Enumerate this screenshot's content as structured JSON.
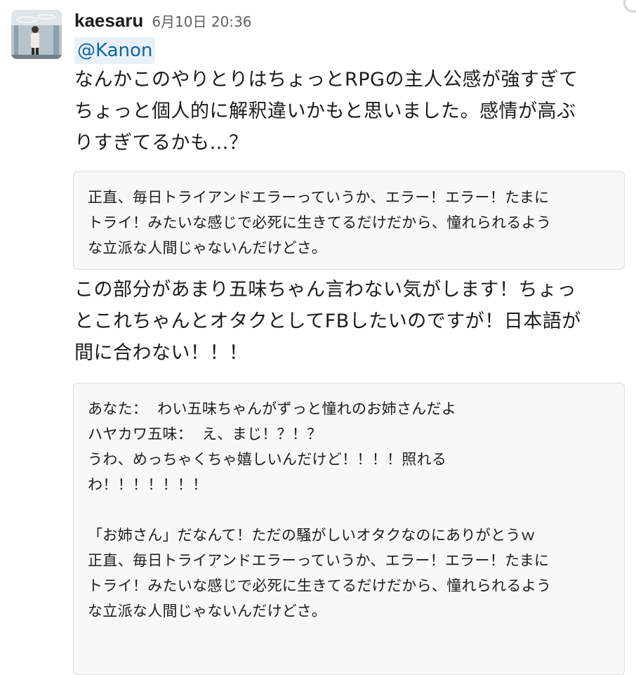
{
  "message": {
    "sender": "kaesaru",
    "timestamp": "6月10日 20:36",
    "mention": "@Kanon",
    "paragraph_1": "なんかこのやりとりはちょっとRPGの主人公感が強すぎて\nちょっと個人的に解釈違いかもと思いました。感情が高ぶ\nりすぎてるかも…？",
    "quote_1": "正直、毎日トライアンドエラーっていうか、エラー！エラー！たまに\nトライ！みたいな感じで必死に生きてるだけだから、憧れられるよう\nな立派な人間じゃないんだけどさ。",
    "paragraph_2": "この部分があまり五味ちゃん言わない気がします！ちょっ\nとこれちゃんとオタクとしてFBしたいのですが！日本語が\n間に合わない！！！",
    "quote_2": "あなた：  わい五味ちゃんがずっと憧れのお姉さんだよ\nハヤカワ五味：  え、まじ！？！？\nうわ、めっちゃくちゃ嬉しいんだけど！！！！照れる\nわ！！！！！！！\n\n「お姉さん」だなんて！ただの騒がしいオタクなのにありがとうｗ\n正直、毎日トライアンドエラーっていうか、エラー！エラー！たまに\nトライ！みたいな感じで必死に生きてるだけだから、憧れられるよう\nな立派な人間じゃないんだけどさ。"
  },
  "avatar": {
    "icon": "user-avatar-photo"
  },
  "colors": {
    "mention_bg": "#e8f1f8",
    "mention_text": "#1264a3",
    "quote_bg": "#f8f8f8",
    "quote_border": "#dcdcdc",
    "timestamp": "#616061"
  }
}
